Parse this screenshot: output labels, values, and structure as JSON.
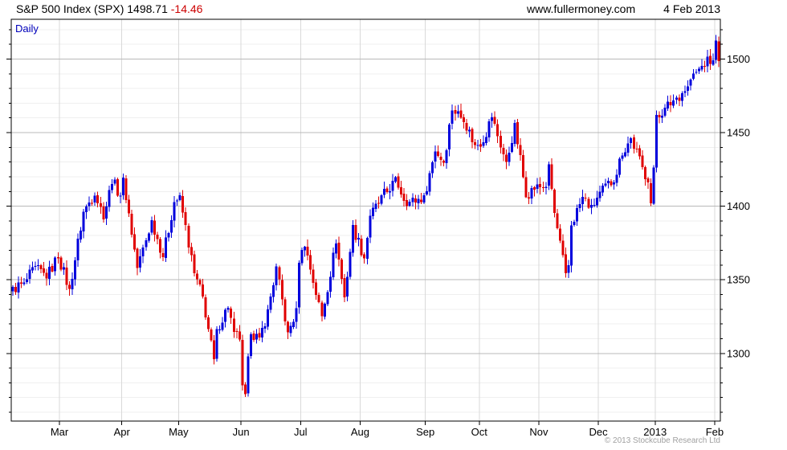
{
  "header": {
    "title": "S&P 500 Index (SPX)",
    "last_price": "1498.71",
    "change": "-14.46",
    "website": "www.fullermoney.com",
    "date": "4 Feb 2013"
  },
  "timeframe_label": "Daily",
  "copyright": "© 2013 Stockcube Research Ltd",
  "colors": {
    "up": "#0000dd",
    "down": "#e00000",
    "change_text": "#cc0000",
    "timeframe_text": "#0000bb",
    "grid_minor": "#efefef",
    "grid_month": "#d9d9d9",
    "grid_major": "#b9b9b9",
    "axis": "#000000",
    "copyright_text": "#a0a0a0"
  },
  "chart_data": {
    "type": "candlestick",
    "title": "S&P 500 Index (SPX) Daily",
    "instrument": "S&P 500 Index (SPX)",
    "timeframe": "Daily",
    "last_close": 1498.71,
    "last_change": -14.46,
    "num_days": 250,
    "y_axis": {
      "ticks": [
        1300,
        1350,
        1400,
        1450,
        1500
      ],
      "minor_step": 10,
      "minor_from": 1260,
      "minor_to": 1520,
      "range": [
        1254,
        1527
      ],
      "side": "right"
    },
    "x_axis": {
      "months": [
        {
          "label": "Mar",
          "day": 17
        },
        {
          "label": "Apr",
          "day": 39
        },
        {
          "label": "May",
          "day": 59
        },
        {
          "label": "Jun",
          "day": 81
        },
        {
          "label": "Jul",
          "day": 102
        },
        {
          "label": "Aug",
          "day": 123
        },
        {
          "label": "Sep",
          "day": 146
        },
        {
          "label": "Oct",
          "day": 165
        },
        {
          "label": "Nov",
          "day": 186
        },
        {
          "label": "Dec",
          "day": 207
        },
        {
          "label": "2013",
          "day": 227
        },
        {
          "label": "Feb",
          "day": 248
        }
      ]
    },
    "waypoints_day_close": [
      [
        0,
        1344
      ],
      [
        4,
        1347
      ],
      [
        8,
        1358
      ],
      [
        12,
        1352
      ],
      [
        16,
        1366
      ],
      [
        20,
        1343
      ],
      [
        25,
        1396
      ],
      [
        29,
        1409
      ],
      [
        32,
        1393
      ],
      [
        35,
        1417
      ],
      [
        38,
        1408
      ],
      [
        39,
        1419
      ],
      [
        44,
        1358
      ],
      [
        49,
        1390
      ],
      [
        53,
        1366
      ],
      [
        57,
        1403
      ],
      [
        59,
        1406
      ],
      [
        64,
        1354
      ],
      [
        67,
        1338
      ],
      [
        71,
        1295
      ],
      [
        72,
        1316
      ],
      [
        76,
        1332
      ],
      [
        78,
        1313
      ],
      [
        80,
        1310
      ],
      [
        81,
        1278
      ],
      [
        82,
        1272
      ],
      [
        84,
        1315
      ],
      [
        87,
        1309
      ],
      [
        90,
        1329
      ],
      [
        93,
        1358
      ],
      [
        97,
        1313
      ],
      [
        100,
        1329
      ],
      [
        101,
        1362
      ],
      [
        103,
        1374
      ],
      [
        109,
        1325
      ],
      [
        114,
        1376
      ],
      [
        117,
        1338
      ],
      [
        120,
        1386
      ],
      [
        124,
        1365
      ],
      [
        126,
        1394
      ],
      [
        135,
        1418
      ],
      [
        139,
        1402
      ],
      [
        145,
        1406
      ],
      [
        149,
        1438
      ],
      [
        152,
        1430
      ],
      [
        155,
        1466
      ],
      [
        159,
        1459
      ],
      [
        163,
        1441
      ],
      [
        166,
        1445
      ],
      [
        169,
        1461
      ],
      [
        174,
        1429
      ],
      [
        177,
        1455
      ],
      [
        181,
        1408
      ],
      [
        184,
        1412
      ],
      [
        188,
        1414
      ],
      [
        189,
        1428
      ],
      [
        191,
        1395
      ],
      [
        195,
        1353
      ],
      [
        196,
        1360
      ],
      [
        197,
        1387
      ],
      [
        201,
        1406
      ],
      [
        204,
        1399
      ],
      [
        207,
        1409
      ],
      [
        212,
        1418
      ],
      [
        215,
        1436
      ],
      [
        218,
        1446
      ],
      [
        222,
        1426
      ],
      [
        224,
        1418
      ],
      [
        225,
        1402
      ],
      [
        226,
        1426
      ],
      [
        227,
        1462
      ],
      [
        230,
        1466
      ],
      [
        233,
        1472
      ],
      [
        238,
        1481
      ],
      [
        239,
        1486
      ],
      [
        243,
        1495
      ],
      [
        245,
        1500
      ],
      [
        247,
        1498
      ],
      [
        248,
        1513
      ],
      [
        249,
        1498.71
      ]
    ],
    "key_levels": {
      "jun_2012_low": 1266,
      "sep_2012_high": 1474,
      "nov_2012_low": 1343,
      "feb_2013_high": 1513
    }
  }
}
